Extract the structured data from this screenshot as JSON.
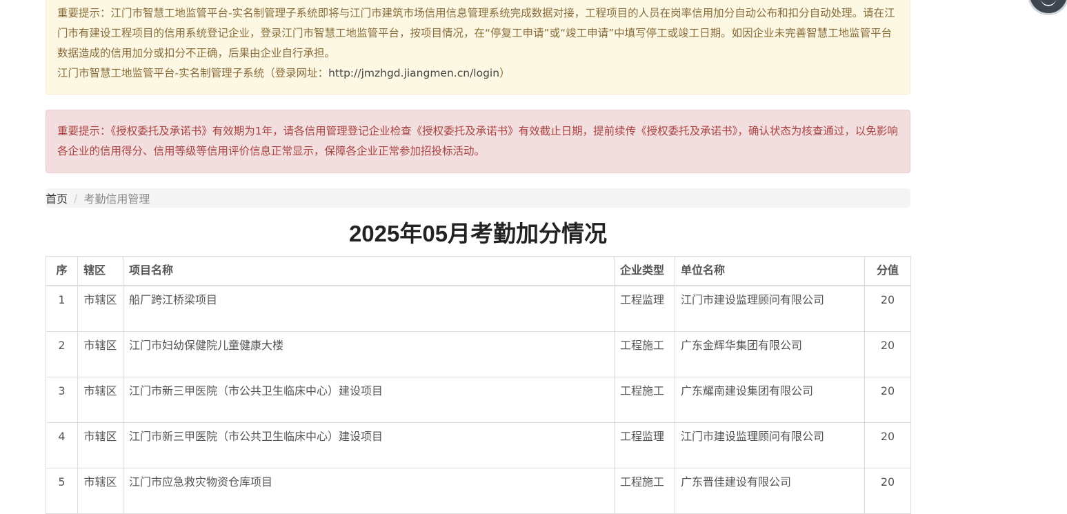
{
  "notices": {
    "warning": {
      "text": "重要提示：江门市智慧工地监管平台-实名制管理子系统即将与江门市建筑市场信用信息管理系统完成数据对接，工程项目的人员在岗率信用加分自动公布和扣分自动处理。请在江门市有建设工程项目的信用系统登记企业，登录江门市智慧工地监管平台，按项目情况，在“停复工申请”或“竣工申请”中填写停工或竣工日期。如因企业未完善智慧工地监管平台数据造成的信用加分或扣分不正确，后果由企业自行承担。",
      "link_prefix": "江门市智慧工地监管平台-实名制管理子系统（登录网址：",
      "link_url": "http://jmzhgd.jiangmen.cn/login",
      "link_suffix": "）"
    },
    "danger": {
      "text": "重要提示：《授权委托及承诺书》有效期为1年，请各信用管理登记企业检查《授权委托及承诺书》有效截止日期，提前续传《授权委托及承诺书》，确认状态为核查通过，以免影响各企业的信用得分、信用等级等信用评价信息正常显示，保障各企业正常参加招投标活动。"
    }
  },
  "breadcrumb": {
    "home": "首页",
    "separator": "/",
    "current": "考勤信用管理"
  },
  "page_title": "2025年05月考勤加分情况",
  "table": {
    "headers": [
      "序",
      "辖区",
      "项目名称",
      "企业类型",
      "单位名称",
      "分值"
    ],
    "rows": [
      [
        "1",
        "市辖区",
        "船厂跨江桥梁项目",
        "工程监理",
        "江门市建设监理顾问有限公司",
        "20"
      ],
      [
        "2",
        "市辖区",
        "江门市妇幼保健院儿童健康大楼",
        "工程施工",
        "广东金辉华集团有限公司",
        "20"
      ],
      [
        "3",
        "市辖区",
        "江门市新三甲医院（市公共卫生临床中心）建设项目",
        "工程施工",
        "广东耀南建设集团有限公司",
        "20"
      ],
      [
        "4",
        "市辖区",
        "江门市新三甲医院（市公共卫生临床中心）建设项目",
        "工程监理",
        "江门市建设监理顾问有限公司",
        "20"
      ],
      [
        "5",
        "市辖区",
        "江门市应急救灾物资仓库项目",
        "工程施工",
        "广东晋佳建设有限公司",
        "20"
      ]
    ]
  },
  "colors": {
    "warning_bg": "#fcf8e3",
    "warning_text": "#8a6d3b",
    "danger_bg": "#f2dede",
    "danger_text": "#a94442"
  }
}
